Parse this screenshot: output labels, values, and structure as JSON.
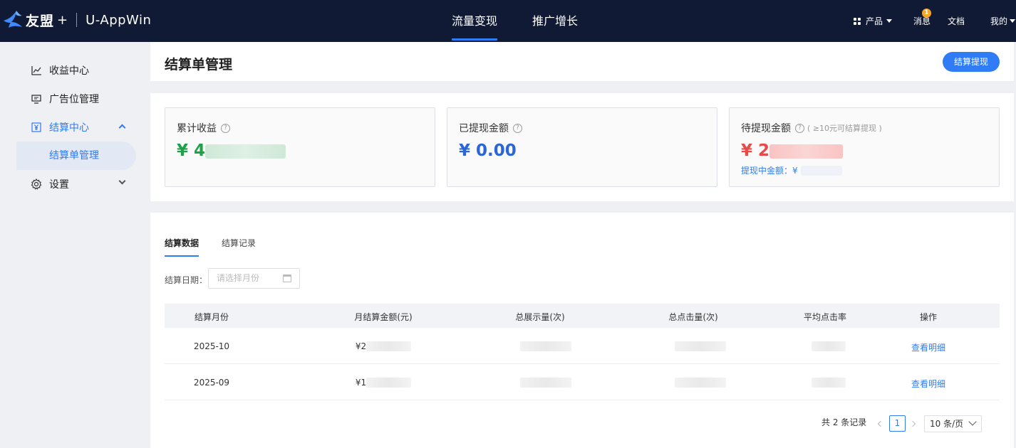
{
  "topbar": {
    "brand": "友盟",
    "brand_plus": "+",
    "app_name": "U-AppWin",
    "nav_tabs": [
      {
        "label": "流量变现",
        "active": true
      },
      {
        "label": "推广增长",
        "active": false
      }
    ],
    "product_menu": "产品",
    "messages_label": "消息",
    "messages_badge": "1",
    "docs_label": "文档",
    "mine_label": "我的"
  },
  "sidebar": {
    "items": [
      {
        "label": "收益中心",
        "icon": "line-chart-icon"
      },
      {
        "label": "广告位管理",
        "icon": "monitor-icon"
      },
      {
        "label": "结算中心",
        "icon": "yuan-icon",
        "expanded": true
      },
      {
        "label": "结算单管理",
        "selected": true
      },
      {
        "label": "设置",
        "icon": "gear-icon",
        "expanded": false
      }
    ]
  },
  "header": {
    "title": "结算单管理",
    "action_button": "结算提现"
  },
  "stats": [
    {
      "label": "累计收益",
      "value": "¥ 4",
      "color": "#21a04a"
    },
    {
      "label": "已提现金额",
      "value": "¥ 0.00",
      "color": "#2b66d9"
    },
    {
      "label": "待提现金额",
      "hint": "( ≥10元可结算提现 )",
      "value": "¥ 2",
      "color": "#e84a4a",
      "sub_label": "提现中金额：¥"
    }
  ],
  "data_panel": {
    "tabs": [
      {
        "label": "结算数据",
        "active": true
      },
      {
        "label": "结算记录",
        "active": false
      }
    ],
    "filter": {
      "label": "结算日期：",
      "placeholder": "请选择月份"
    },
    "columns": [
      "结算月份",
      "月结算金额(元)",
      "总展示量(次)",
      "总点击量(次)",
      "平均点击率",
      "操作"
    ],
    "rows": [
      {
        "month": "2025-10",
        "amount": "¥2",
        "action": "查看明细"
      },
      {
        "month": "2025-09",
        "amount": "¥1",
        "action": "查看明细"
      }
    ],
    "pagination": {
      "total_text": "共 2 条记录",
      "current_page": "1",
      "page_size": "10 条/页"
    }
  },
  "colors": {
    "topbar_bg": "#111a35",
    "accent": "#2f7cf6",
    "page_bg": "#eef0f4"
  }
}
